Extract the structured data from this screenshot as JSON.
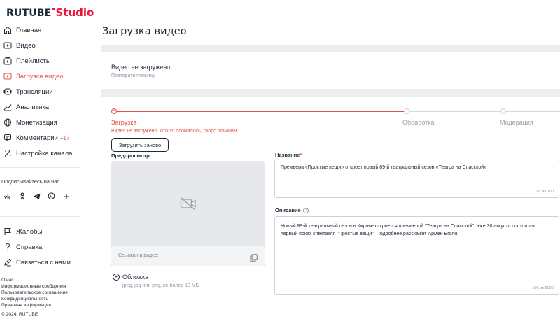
{
  "brand": {
    "name": "RUTUBE",
    "product": "Studio",
    "accent": "#ed143b"
  },
  "sidebar": {
    "items": [
      {
        "label": "Главная",
        "icon": "home-icon"
      },
      {
        "label": "Видео",
        "icon": "video-icon"
      },
      {
        "label": "Плейлисты",
        "icon": "playlist-icon"
      },
      {
        "label": "Загрузка видео",
        "icon": "upload-video-icon",
        "active": true
      },
      {
        "label": "Трансляции",
        "icon": "broadcast-icon"
      },
      {
        "label": "Аналитика",
        "icon": "analytics-icon"
      },
      {
        "label": "Монетизация",
        "icon": "monetization-icon"
      },
      {
        "label": "Комментарии",
        "icon": "comments-icon",
        "badge": "+17"
      },
      {
        "label": "Настройка канала",
        "icon": "channel-settings-icon"
      }
    ],
    "follow_label": "Подписывайтесь на нас",
    "socials": [
      "VK",
      "OK",
      "Telegram",
      "Viber",
      "More"
    ],
    "secondary_items": [
      {
        "label": "Жалобы",
        "icon": "flag-icon"
      },
      {
        "label": "Справка",
        "icon": "help-icon"
      },
      {
        "label": "Связаться с нами",
        "icon": "contact-icon"
      }
    ],
    "footer_links": [
      "О нас",
      "Информационные сообщения",
      "Пользовательское соглашение",
      "Конфиденциальность",
      "Правовая информация"
    ],
    "copyright": "© 2024, RUTUBE"
  },
  "main": {
    "title": "Загрузка видео",
    "error_card": {
      "title": "Видео не загружено",
      "subtitle": "Повторите попытку"
    },
    "steps": [
      {
        "label": "Загрузка",
        "state": "error"
      },
      {
        "label": "Обработка",
        "state": "pending"
      },
      {
        "label": "Модерация",
        "state": "pending"
      }
    ],
    "step_error": "Видео не загружено. Что-то сломалось, скоро починим",
    "retry_label": "Загрузить заново",
    "preview": {
      "label": "Предпросмотр",
      "link_label": "Ссылка на видео:"
    },
    "cover": {
      "label": "Обложка",
      "hint": "jpeg, jpg или png, не более 10 МБ"
    },
    "name_field": {
      "label": "Название",
      "required_mark": "*",
      "value": "Премьера «Простые вещи» откроет  новый 89-й театральный сезон «Театра на Спасской»",
      "counter": "82 из 100"
    },
    "description_field": {
      "label": "Описание",
      "value": "Новый 89-й театральный сезон в Кирове откроется премьерой \"Театра на Спасской\". Уже 30 августа состоится первый показ спектакля \"Простые вещи\". Подробнее расскажет  Армен Егоян.",
      "counter": "196 из 5000"
    }
  }
}
